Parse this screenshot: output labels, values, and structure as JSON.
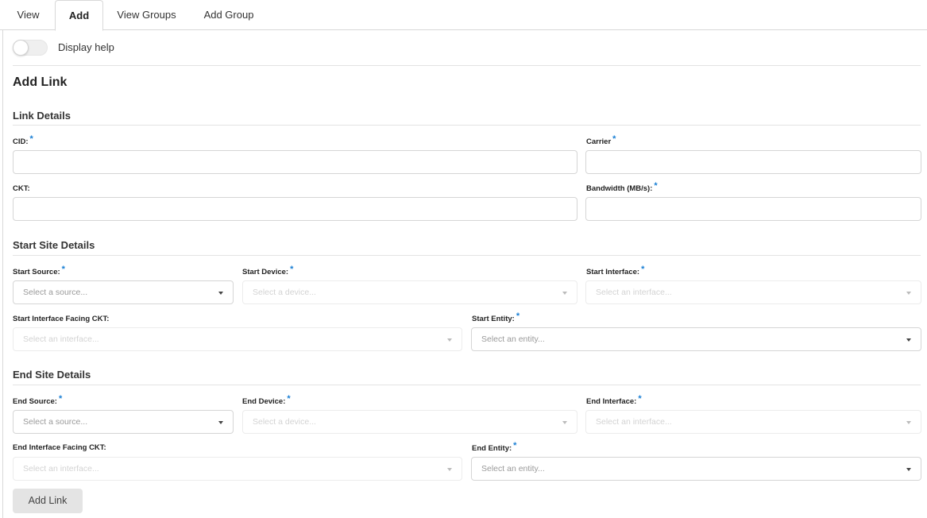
{
  "tabs": [
    {
      "label": "View",
      "active": false
    },
    {
      "label": "Add",
      "active": true
    },
    {
      "label": "View Groups",
      "active": false
    },
    {
      "label": "Add Group",
      "active": false
    }
  ],
  "help_toggle": {
    "label": "Display help",
    "on": false
  },
  "page_title": "Add Link",
  "required_mark": "*",
  "colors": {
    "required": "#1a7fd4",
    "button_bg": "#e4e4e4"
  },
  "link_details": {
    "title": "Link Details",
    "cid": {
      "label": "CID:",
      "value": ""
    },
    "carrier": {
      "label": "Carrier",
      "value": ""
    },
    "ckt": {
      "label": "CKT:",
      "value": ""
    },
    "bandwidth": {
      "label": "Bandwidth (MB/s):",
      "value": ""
    }
  },
  "start_site": {
    "title": "Start Site Details",
    "source": {
      "label": "Start Source:",
      "placeholder": "Select a source..."
    },
    "device": {
      "label": "Start Device:",
      "placeholder": "Select a device..."
    },
    "interface": {
      "label": "Start Interface:",
      "placeholder": "Select an interface..."
    },
    "facing": {
      "label": "Start Interface Facing CKT:",
      "placeholder": "Select an interface..."
    },
    "entity": {
      "label": "Start Entity:",
      "placeholder": "Select an entity..."
    }
  },
  "end_site": {
    "title": "End Site Details",
    "source": {
      "label": "End Source:",
      "placeholder": "Select a source..."
    },
    "device": {
      "label": "End Device:",
      "placeholder": "Select a device..."
    },
    "interface": {
      "label": "End Interface:",
      "placeholder": "Select an interface..."
    },
    "facing": {
      "label": "End Interface Facing CKT:",
      "placeholder": "Select an interface..."
    },
    "entity": {
      "label": "End Entity:",
      "placeholder": "Select an entity..."
    }
  },
  "submit_label": "Add Link"
}
